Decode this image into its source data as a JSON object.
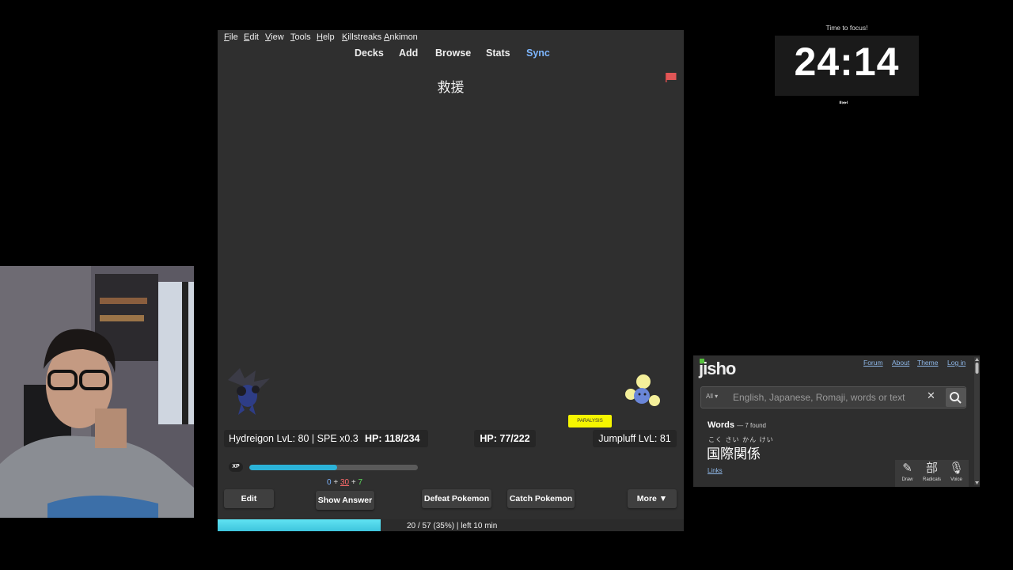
{
  "anki": {
    "menu": [
      "File",
      "Edit",
      "View",
      "Tools",
      "Help",
      "Killstreaks",
      "Ankimon"
    ],
    "toplinks": {
      "decks": "Decks",
      "add": "Add",
      "browse": "Browse",
      "stats": "Stats",
      "sync": "Sync"
    },
    "card_word": "救援",
    "battle": {
      "player_info": "Hydreigon LvL: 80 | SPE x0.3",
      "player_hp": "HP: 118/234",
      "enemy_hp": "HP: 77/222",
      "enemy_info": "Jumpluff LvL: 81",
      "status": "PARALYSIS",
      "xp_label": "XP",
      "xp_fraction": 0.52,
      "xp_parts": [
        "0",
        "+",
        "30",
        "+",
        "7"
      ]
    },
    "buttons": {
      "edit": "Edit",
      "show_answer": "Show Answer",
      "defeat": "Defeat Pokemon",
      "catch": "Catch Pokemon",
      "more": "More ▼"
    },
    "progress": {
      "text": "20 / 57 (35%) | left 10 min",
      "fraction": 0.35
    }
  },
  "timer": {
    "title": "Time to focus!",
    "time": "24:14",
    "controls": "⏸⏭"
  },
  "jisho": {
    "logo": "jisho",
    "nav": [
      "Forum",
      "About",
      "Theme",
      "Log in"
    ],
    "search": {
      "scope": "All ▾",
      "placeholder": "English, Japanese, Romaji, words or text"
    },
    "words_title": "Words",
    "words_count": "— 7 found",
    "result": {
      "furigana": "こく さい かん けい",
      "word": "国際関係"
    },
    "links": "Links",
    "tools": [
      {
        "icon": "✎",
        "label": "Draw"
      },
      {
        "icon": "部",
        "label": "Radicals"
      },
      {
        "icon": "🎙",
        "label": "Voice"
      }
    ]
  },
  "colors": {
    "accent_sync": "#7db6ff",
    "xp_bar": "#2bb3d8",
    "progress": "#4fd3e8",
    "status_badge": "#f6f600",
    "enemy_hp_text": "#ffffff"
  }
}
